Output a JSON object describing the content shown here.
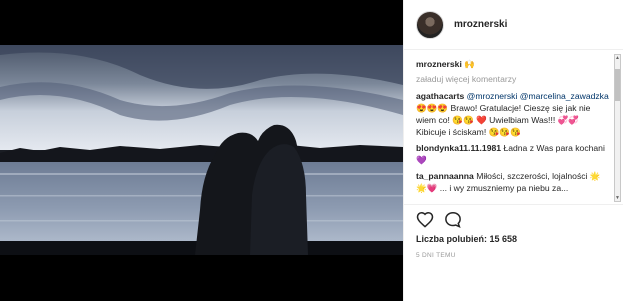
{
  "header": {
    "username": "mroznerski"
  },
  "caption": {
    "username": "mroznerski",
    "text": "🙌"
  },
  "comments": {
    "load_more": "załaduj więcej komentarzy",
    "items": [
      {
        "username": "agathacarts",
        "mention1": "@mroznerski",
        "mention2": "@marcelina_zawadzka",
        "text": "😍😍😍 Brawo! Gratulacje! Cieszę się jak nie wiem co! 😘😘 ❤️ Uwielbiam Was!!! 💞💞 Kibicuje i ściskam! 😘😘😘"
      },
      {
        "username": "blondynka11.11.1981",
        "text": "Ładna z Was para kochani 💜"
      },
      {
        "username": "ta_pannaanna",
        "text": "Miłości, szczerości, lojalności 🌟🌟💗 ... i wy zmuszniemy pa niebu za..."
      }
    ]
  },
  "likes": {
    "label": "Liczba polubień: 15 658"
  },
  "timestamp": "5 DNI TEMU",
  "icons": {
    "like": "heart-icon",
    "comment": "comment-icon"
  }
}
